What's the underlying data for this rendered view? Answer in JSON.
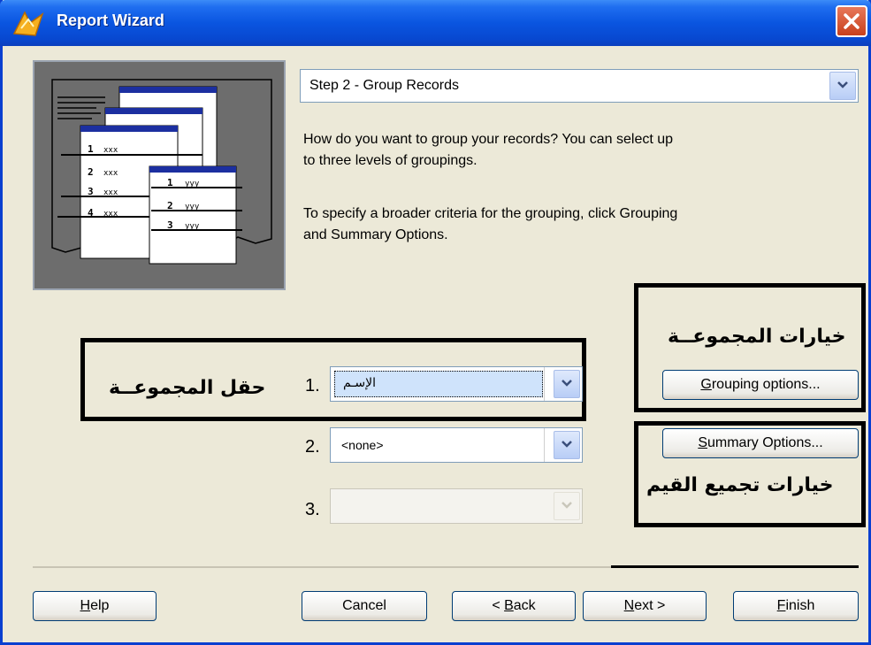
{
  "window": {
    "title": "Report Wizard",
    "close_icon": "close-icon",
    "app_icon": "report-wizard-icon"
  },
  "step": {
    "selected": "Step 2 - Group Records"
  },
  "instructions": {
    "line1": "How do you want to group your records? You can select up",
    "line2": "to three levels of groupings.",
    "line3": "To specify a broader criteria for the grouping, click Grouping",
    "line4": "and Summary Options."
  },
  "preview": {
    "row_labels": [
      "1",
      "2",
      "3",
      "4"
    ],
    "cell_xxx": "xxx",
    "cell_yyy": "yyy"
  },
  "annotations": {
    "group_field": "حقل المجموعــة",
    "grouping_options": "خيارات المجموعــة",
    "summary_options": "خيارات تجميع القيم"
  },
  "grouping": {
    "levels": [
      {
        "number": "1.",
        "value": "الإسـم"
      },
      {
        "number": "2.",
        "value": "<none>"
      },
      {
        "number": "3.",
        "value": ""
      }
    ]
  },
  "buttons": {
    "grouping_options": {
      "accel": "G",
      "rest": "rouping options..."
    },
    "summary_options": {
      "accel": "S",
      "rest": "ummary Options..."
    },
    "help": {
      "accel": "H",
      "rest": "elp"
    },
    "cancel": "Cancel",
    "back": {
      "pre": "< ",
      "accel": "B",
      "rest": "ack"
    },
    "next": {
      "accel": "N",
      "rest": "ext >"
    },
    "finish": {
      "accel": "F",
      "rest": "inish"
    }
  },
  "colors": {
    "titlebar": "#0a55e0",
    "dialog_bg": "#ece9d8",
    "highlight": "#cfe3fb"
  }
}
